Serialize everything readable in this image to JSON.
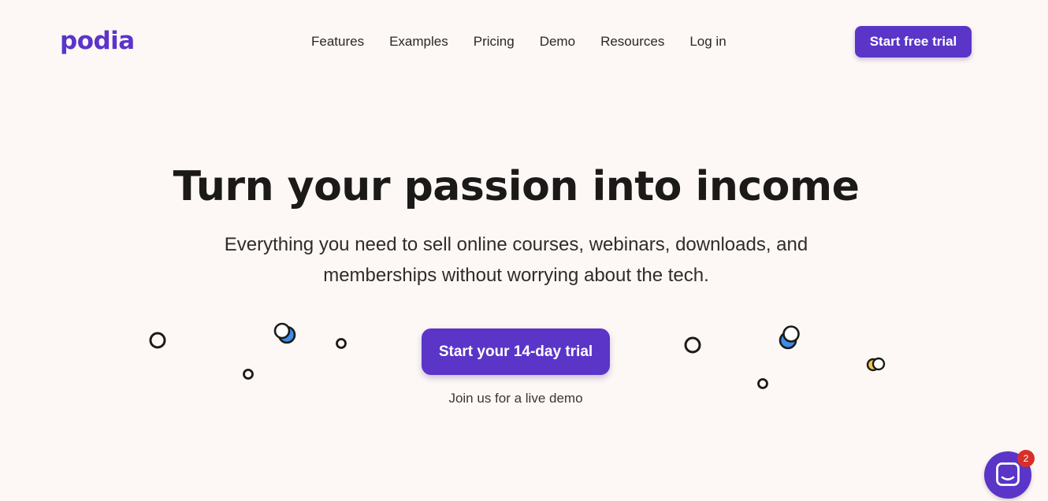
{
  "brand": {
    "logo_text": "podia",
    "accent_color": "#5a35c8",
    "background_color": "#fdf8f5"
  },
  "nav": {
    "items": [
      {
        "label": "Features"
      },
      {
        "label": "Examples"
      },
      {
        "label": "Pricing"
      },
      {
        "label": "Demo"
      },
      {
        "label": "Resources"
      },
      {
        "label": "Log in"
      }
    ],
    "cta_label": "Start free trial"
  },
  "hero": {
    "title": "Turn your passion into income",
    "subtitle": "Everything you need to sell online courses, webinars, downloads, and memberships without worrying about the tech.",
    "cta_label": "Start your 14-day trial",
    "secondary_link": "Join us for a live demo"
  },
  "decorations": {
    "icon": "floating-circles",
    "colors": [
      "#1c1a19",
      "#3b8de8",
      "#f2c94c"
    ]
  },
  "chat_widget": {
    "icon": "chat-icon",
    "badge_count": "2",
    "badge_color": "#d92f2a"
  }
}
